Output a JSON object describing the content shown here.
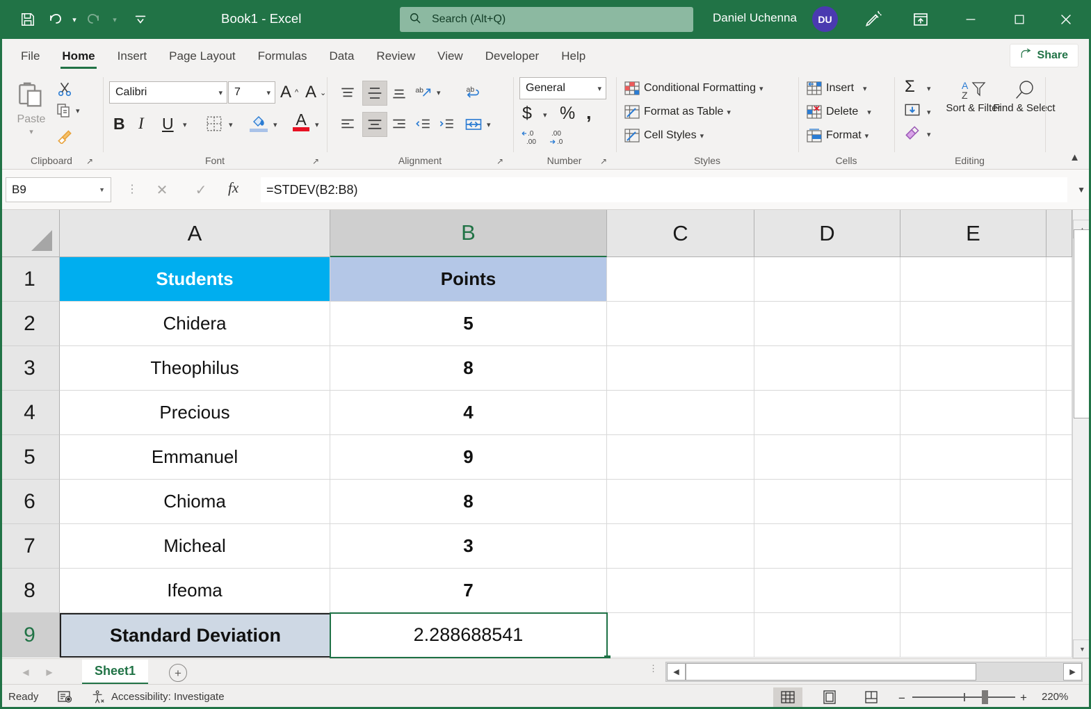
{
  "titlebar": {
    "quick_access": [
      {
        "name": "save-icon",
        "label": "Save"
      },
      {
        "name": "undo-icon",
        "label": "Undo"
      },
      {
        "name": "redo-icon",
        "label": "Redo"
      },
      {
        "name": "customize-quick-access-toolbar-icon",
        "label": "Customize Quick Access Toolbar"
      }
    ],
    "document_title": "Book1  -  Excel",
    "search_placeholder": "Search (Alt+Q)",
    "user_name": "Daniel Uchenna",
    "avatar_initials": "DU",
    "ink_label": "Draw / Ink",
    "ribbon_display_label": "Ribbon Display Options",
    "minimize": "—",
    "maximize": "☐",
    "close": "✕",
    "bg_color": "#217346"
  },
  "tabs": [
    {
      "label": "File",
      "active": false
    },
    {
      "label": "Home",
      "active": true
    },
    {
      "label": "Insert",
      "active": false
    },
    {
      "label": "Page Layout",
      "active": false
    },
    {
      "label": "Formulas",
      "active": false
    },
    {
      "label": "Data",
      "active": false
    },
    {
      "label": "Review",
      "active": false
    },
    {
      "label": "View",
      "active": false
    },
    {
      "label": "Developer",
      "active": false
    },
    {
      "label": "Help",
      "active": false
    }
  ],
  "share": {
    "label": "Share",
    "color": "#217346"
  },
  "ribbon": {
    "groups": {
      "clipboard": {
        "label": "Clipboard",
        "paste_label": "Paste",
        "cut_label": "Cut",
        "copy_label": "Copy",
        "format_painter_label": "Format Painter"
      },
      "font": {
        "label": "Font",
        "font_name": "Calibri",
        "font_size": "7",
        "increase_font_label": "A",
        "decrease_font_label": "A",
        "bold_label": "B",
        "italic_label": "I",
        "underline_label": "U",
        "borders_label": "Borders",
        "fill_color_label": "Fill Color",
        "font_color_label": "Font Color"
      },
      "alignment": {
        "label": "Alignment",
        "top_align_label": "Top Align",
        "middle_align_label": "Middle Align",
        "bottom_align_label": "Bottom Align",
        "orientation_label": "Orientation",
        "align_left_label": "Align Left",
        "center_label": "Center",
        "align_right_label": "Align Right",
        "decrease_indent_label": "Decrease Indent",
        "increase_indent_label": "Increase Indent",
        "wrap_text_label": "Wrap Text",
        "merge_center_label": "Merge & Center"
      },
      "number": {
        "label": "Number",
        "format": "General",
        "currency_label": "$",
        "percent_label": "%",
        "comma_label": ",",
        "increase_decimal_label": "Increase Decimal",
        "decrease_decimal_label": "Decrease Decimal"
      },
      "styles": {
        "label": "Styles",
        "items": [
          {
            "label": "Conditional Formatting"
          },
          {
            "label": "Format as Table"
          },
          {
            "label": "Cell Styles"
          }
        ]
      },
      "cells": {
        "label": "Cells",
        "items": [
          {
            "label": "Insert"
          },
          {
            "label": "Delete"
          },
          {
            "label": "Format"
          }
        ]
      },
      "editing": {
        "label": "Editing",
        "autosum_label": "Σ",
        "fill_label": "Fill",
        "clear_label": "Clear",
        "sort_filter_label": "Sort & Filter",
        "find_select_label": "Find & Select"
      }
    },
    "collapse_label": "Collapse the Ribbon"
  },
  "formula_bar": {
    "name_box": "B9",
    "cancel_label": "✕",
    "enter_label": "✓",
    "fx_label": "fx",
    "formula": "=STDEV(B2:B8)"
  },
  "sheet": {
    "columns": [
      "A",
      "B",
      "C",
      "D",
      "E"
    ],
    "selected_column": "B",
    "rows": [
      "1",
      "2",
      "3",
      "4",
      "5",
      "6",
      "7",
      "8",
      "9"
    ],
    "selected_row": "9",
    "cells": {
      "A1": "Students",
      "B1": "Points",
      "A2": "Chidera",
      "B2": "5",
      "A3": "Theophilus",
      "B3": "8",
      "A4": "Precious",
      "B4": "4",
      "A5": "Emmanuel",
      "B5": "9",
      "A6": "Chioma",
      "B6": "8",
      "A7": "Micheal",
      "B7": "3",
      "A8": "Ifeoma",
      "B8": "7",
      "A9": "Standard Deviation",
      "B9": "2.288688541"
    },
    "colors": {
      "header_a_fill": "#00aeef",
      "header_a_text": "#ffffff",
      "header_b_fill": "#b4c7e7",
      "header_b_text": "#000000",
      "label_a9_fill": "#ced8e4",
      "selection_border": "#1e7145"
    },
    "active_cell": "B9"
  },
  "sheet_tabs": {
    "prev_label": "◀",
    "next_label": "▶",
    "tabs": [
      {
        "label": "Sheet1",
        "active": true
      }
    ],
    "add_sheet_label": "+"
  },
  "status_bar": {
    "mode": "Ready",
    "macro_label": "Record Macro",
    "accessibility": "Accessibility: Investigate",
    "views": [
      {
        "name": "normal-view",
        "label": "Normal",
        "active": true
      },
      {
        "name": "page-layout-view",
        "label": "Page Layout",
        "active": false
      },
      {
        "name": "page-break-preview",
        "label": "Page Break Preview",
        "active": false
      }
    ],
    "zoom_out_label": "−",
    "zoom_in_label": "+",
    "zoom_level": "220%"
  }
}
